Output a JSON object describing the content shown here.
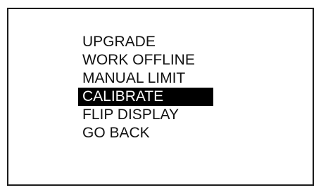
{
  "menu": {
    "items": [
      {
        "label": "UPGRADE",
        "selected": false
      },
      {
        "label": "WORK OFFLINE",
        "selected": false
      },
      {
        "label": "MANUAL LIMIT",
        "selected": false
      },
      {
        "label": "CALIBRATE",
        "selected": true
      },
      {
        "label": "FLIP DISPLAY",
        "selected": false
      },
      {
        "label": "GO BACK",
        "selected": false
      }
    ]
  },
  "colors": {
    "background": "#ffffff",
    "border": "#1a1a1a",
    "text": "#111111",
    "highlight": "#000000",
    "highlight_text": "#ffffff"
  }
}
